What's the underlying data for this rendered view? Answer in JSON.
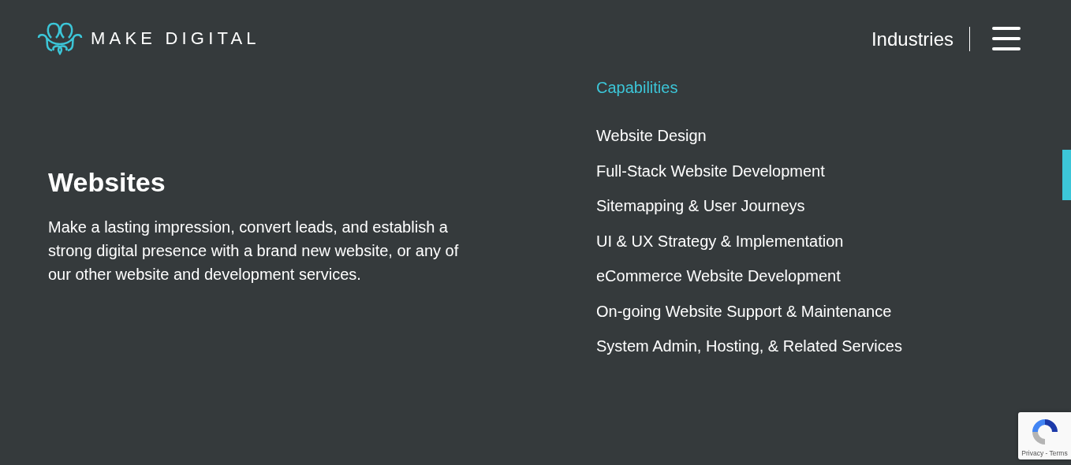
{
  "logo": {
    "text": "MAKE DIGITAL"
  },
  "nav": {
    "link": "Industries"
  },
  "section": {
    "title": "Websites",
    "description": "Make a lasting impression, convert leads, and establish a strong digital presence with a brand new website, or any of our other website and development services."
  },
  "capabilities": {
    "heading": "Capabilities",
    "items": [
      "Website Design",
      "Full-Stack Website Development",
      "Sitemapping & User Journeys",
      "UI & UX Strategy & Implementation",
      "eCommerce Website Development",
      "On-going Website Support & Maintenance",
      "System Admin, Hosting, & Related Services"
    ]
  },
  "recaptcha": {
    "links": "Privacy - Terms"
  }
}
